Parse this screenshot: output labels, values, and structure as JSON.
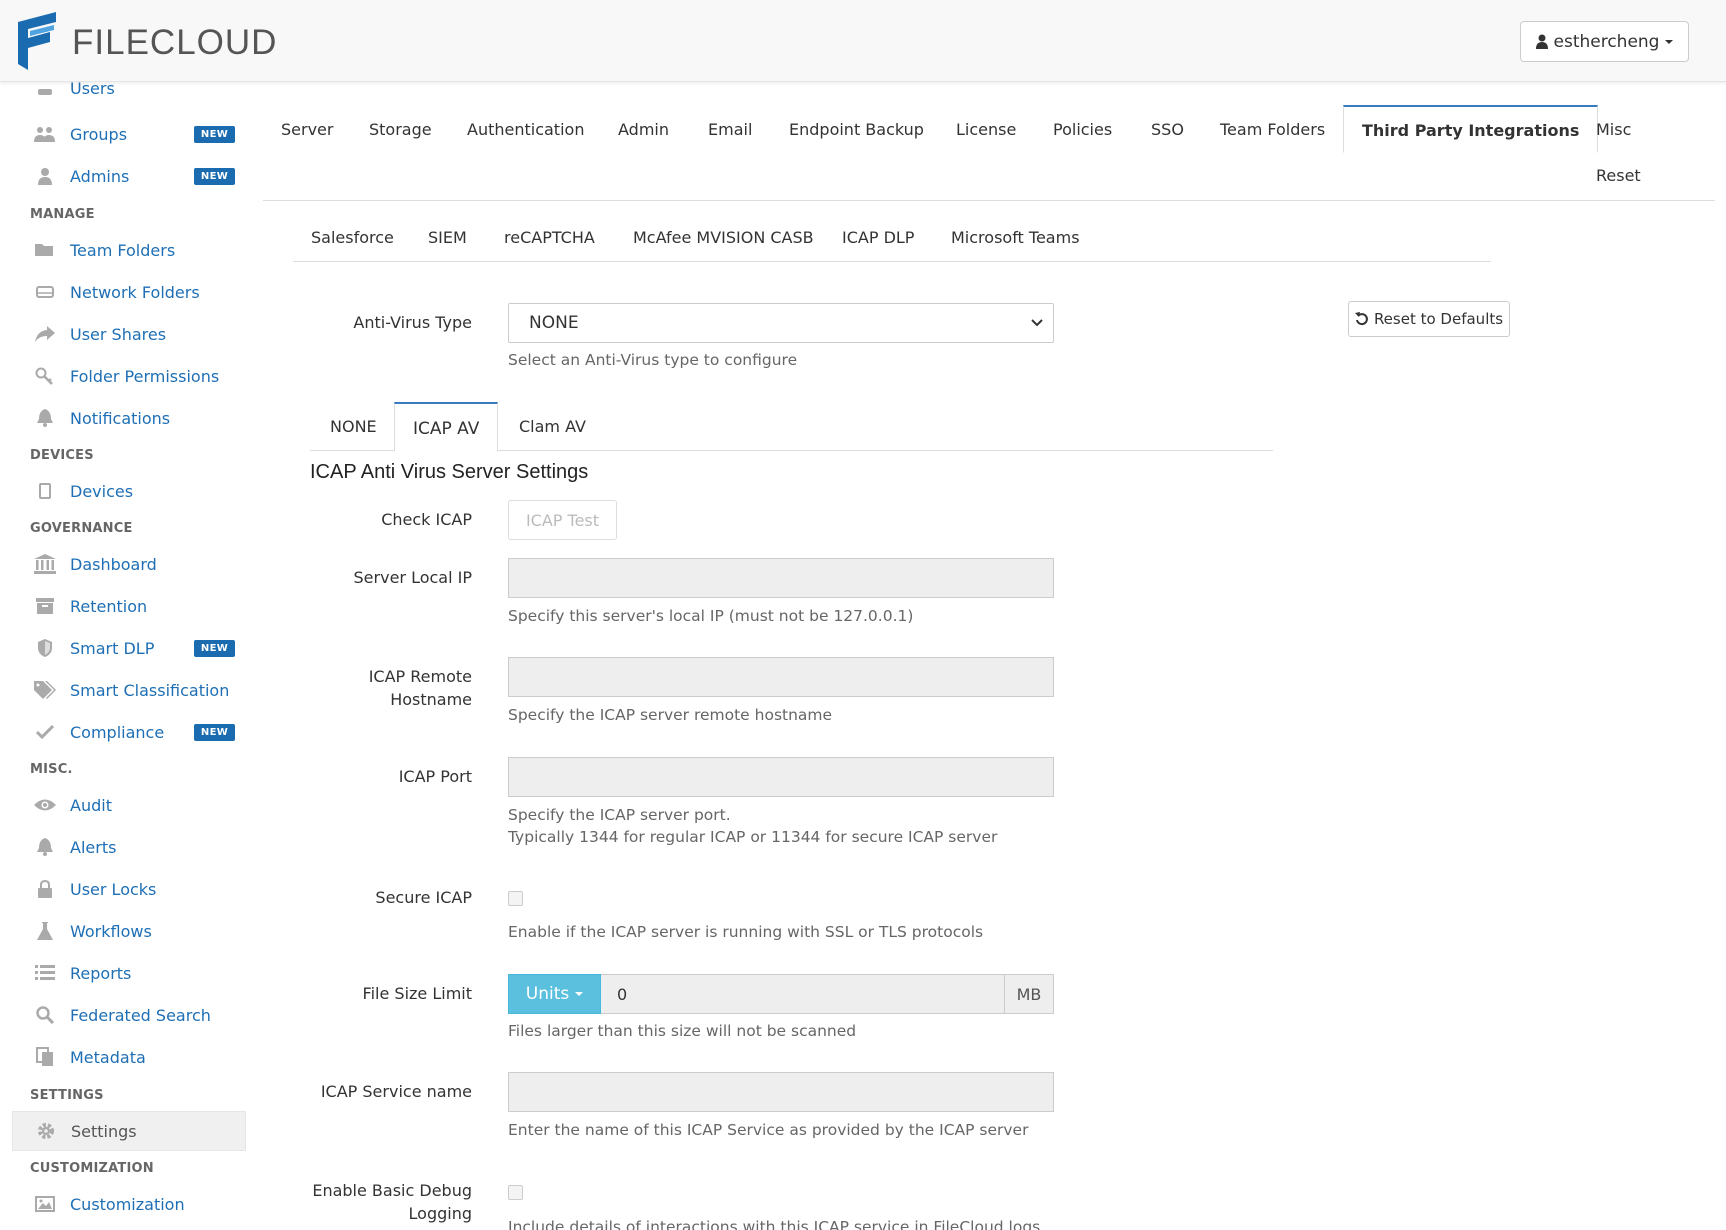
{
  "app": {
    "logo_text": "FILECLOUD",
    "username": "esthercheng"
  },
  "sidebar": {
    "partial_item": "Users",
    "new_badge": "NEW",
    "items_top": [
      {
        "label": "Groups",
        "icon": "users-icon",
        "badge": true
      },
      {
        "label": "Admins",
        "icon": "admin-icon",
        "badge": true
      }
    ],
    "headers": {
      "manage": "MANAGE",
      "devices": "DEVICES",
      "governance": "GOVERNANCE",
      "misc": "MISC.",
      "settings": "SETTINGS",
      "customization": "CUSTOMIZATION"
    },
    "manage": [
      {
        "label": "Team Folders"
      },
      {
        "label": "Network Folders"
      },
      {
        "label": "User Shares"
      },
      {
        "label": "Folder Permissions"
      },
      {
        "label": "Notifications"
      }
    ],
    "devices": [
      {
        "label": "Devices"
      }
    ],
    "governance": [
      {
        "label": "Dashboard"
      },
      {
        "label": "Retention"
      },
      {
        "label": "Smart DLP",
        "badge": true
      },
      {
        "label": "Smart Classification"
      },
      {
        "label": "Compliance",
        "badge": true
      }
    ],
    "misc": [
      {
        "label": "Audit"
      },
      {
        "label": "Alerts"
      },
      {
        "label": "User Locks"
      },
      {
        "label": "Workflows"
      },
      {
        "label": "Reports"
      },
      {
        "label": "Federated Search"
      },
      {
        "label": "Metadata"
      }
    ],
    "settings": [
      {
        "label": "Settings",
        "active": true
      }
    ],
    "customization": [
      {
        "label": "Customization"
      }
    ]
  },
  "tabs": {
    "main": [
      "Server",
      "Storage",
      "Authentication",
      "Admin",
      "Email",
      "Endpoint Backup",
      "License",
      "Policies",
      "SSO",
      "Team Folders",
      "Third Party Integrations",
      "Misc",
      "Reset"
    ],
    "active_main": "Third Party Integrations",
    "sub": [
      "Salesforce",
      "SIEM",
      "reCAPTCHA",
      "McAfee MVISION CASB",
      "ICAP DLP",
      "Microsoft Teams"
    ]
  },
  "form": {
    "av_type_label": "Anti-Virus Type",
    "av_type_value": "NONE",
    "av_type_help": "Select an Anti-Virus type to configure",
    "reset_defaults": "Reset to Defaults",
    "av_tabs": [
      "NONE",
      "ICAP AV",
      "Clam AV"
    ],
    "active_av_tab": "ICAP AV",
    "section_title": "ICAP Anti Virus Server Settings",
    "check_icap_label": "Check ICAP",
    "icap_test_button": "ICAP Test",
    "server_ip_label": "Server Local IP",
    "server_ip_help": "Specify this server's local IP (must not be 127.0.0.1)",
    "remote_host_label_1": "ICAP Remote",
    "remote_host_label_2": "Hostname",
    "remote_host_help": "Specify the ICAP server remote hostname",
    "port_label": "ICAP Port",
    "port_help_1": "Specify the ICAP server port.",
    "port_help_2": "Typically 1344 for regular ICAP or 11344 for secure ICAP server",
    "secure_label": "Secure ICAP",
    "secure_help": "Enable if the ICAP server is running with SSL or TLS protocols",
    "size_label": "File Size Limit",
    "units_button": "Units",
    "size_value": "0",
    "size_unit": "MB",
    "size_help": "Files larger than this size will not be scanned",
    "service_label": "ICAP Service name",
    "service_help": "Enter the name of this ICAP Service as provided by the ICAP server",
    "debug_label_1": "Enable Basic Debug",
    "debug_label_2": "Logging",
    "debug_help": "Include details of interactions with this ICAP service in FileCloud logs"
  }
}
